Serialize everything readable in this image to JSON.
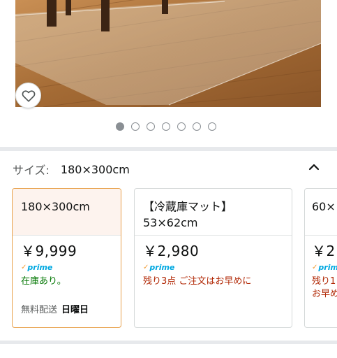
{
  "product": {
    "favorite_icon": "heart-outline-icon",
    "carousel": {
      "count": 7,
      "active_index": 0
    }
  },
  "size": {
    "label": "サイズ:",
    "selected": "180×300cm",
    "toggle_icon": "chevron-up-icon"
  },
  "variants": [
    {
      "title": "180×300cm",
      "price": "￥9,999",
      "prime": "prime",
      "stock": "在庫あり。",
      "stock_status": "in-stock",
      "delivery_label": "無料配送",
      "delivery_day": "日曜日"
    },
    {
      "title_line1": "【冷蔵庫マット】",
      "title_line2": "53×62cm",
      "price": "￥2,980",
      "prime": "prime",
      "stock": "残り3点 ご注文はお早めに",
      "stock_status": "low-stock"
    },
    {
      "title": "60×",
      "price": "￥2",
      "prime": "prime",
      "stock_line1": "残り1",
      "stock_line2": "お早め",
      "stock_status": "low-stock"
    }
  ],
  "colors": {
    "selected_border": "#e8a24d",
    "in_stock": "#007600",
    "low_stock": "#b12704",
    "prime_blue": "#00a8e1"
  }
}
